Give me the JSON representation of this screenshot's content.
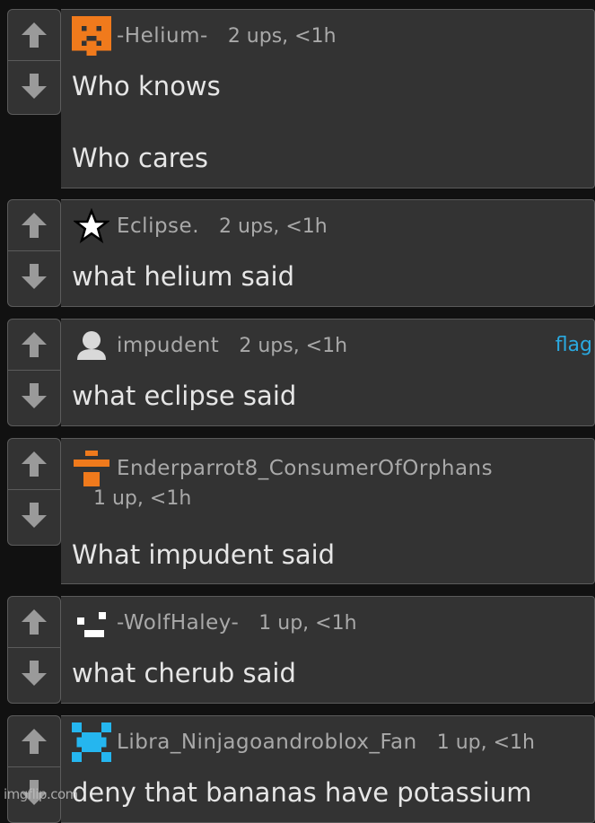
{
  "comments": [
    {
      "avatar": "orange-pixel-face-icon",
      "username": "-Helium-",
      "stats": "2 ups, <1h",
      "lines": [
        "Who knows",
        "Who cares"
      ]
    },
    {
      "avatar": "star-icon",
      "username": "Eclipse.",
      "stats": "2 ups, <1h",
      "lines": [
        "what helium said"
      ]
    },
    {
      "avatar": "default-user-icon",
      "username": "impudent",
      "stats": "2 ups, <1h",
      "flag": "flag",
      "lines": [
        "what eclipse said"
      ]
    },
    {
      "avatar": "orange-bars-icon",
      "username": "Enderparrot8_ConsumerOfOrphans",
      "stats": "1 up, <1h",
      "lines": [
        "What impudent said"
      ]
    },
    {
      "avatar": "white-pixel-face-icon",
      "username": "-WolfHaley-",
      "stats": "1 up, <1h",
      "lines": [
        "what cherub said"
      ]
    },
    {
      "avatar": "blue-pixel-x-icon",
      "username": "Libra_Ninjagoandroblox_Fan",
      "stats": "1 up, <1h",
      "lines": [
        "deny that bananas have potassium"
      ]
    }
  ],
  "watermark": "imgflip.com",
  "colors": {
    "background": "#111111",
    "panel": "#333333",
    "border": "#5b5b5b",
    "username": "#a9a9a9",
    "text": "#e6e6e6",
    "flag": "#2aa9e0",
    "accent_orange": "#f07a1c",
    "accent_blue": "#25b6ef"
  }
}
